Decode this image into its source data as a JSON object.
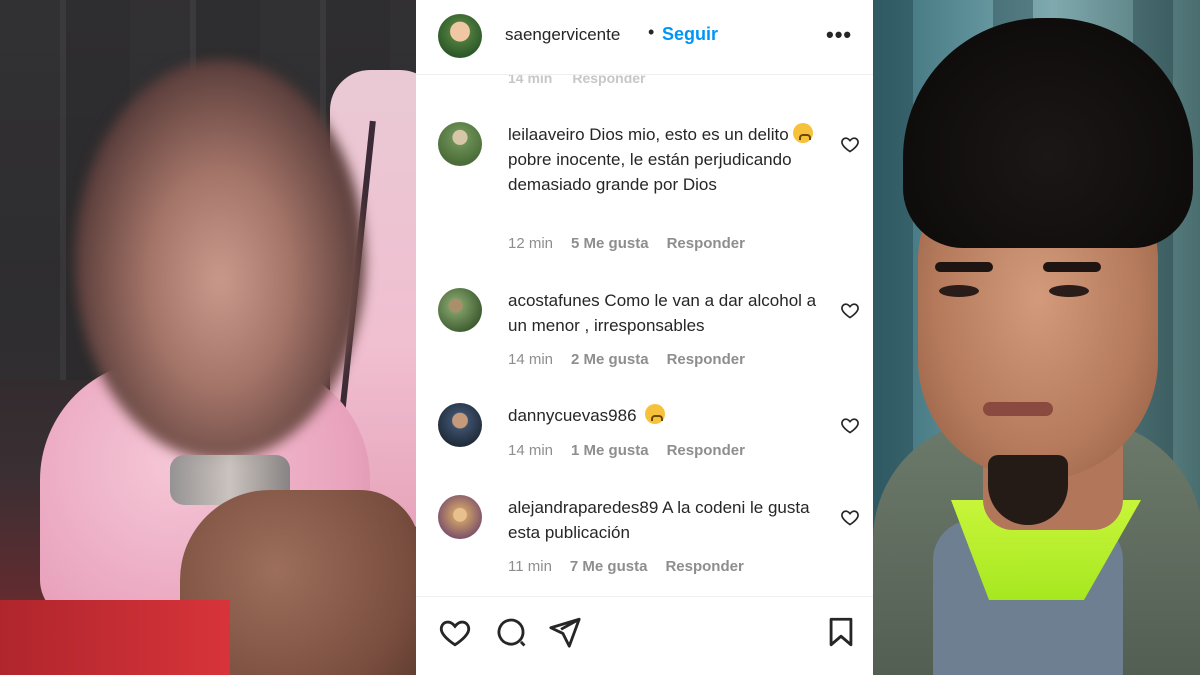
{
  "post": {
    "username": "saengervicente",
    "separator": "•",
    "follow_label": "Seguir",
    "more_label": "•••"
  },
  "ghost_meta": {
    "time": "14 min",
    "reply": "Responder"
  },
  "comments": [
    {
      "username": "leilaaveiro",
      "text": "Dios mio, esto es un delito",
      "emoji": "crying-face",
      "text_after": " pobre inocente, le están perjudicando demasiado grande por Dios",
      "time": "12 min",
      "likes": "5 Me gusta",
      "reply": "Responder",
      "avatar_color": "#6b8f55"
    },
    {
      "username": "acostafunes",
      "text": "Como le van a dar alcohol a un menor , irresponsables",
      "time": "14 min",
      "likes": "2 Me gusta",
      "reply": "Responder",
      "avatar_color": "#7a9a63"
    },
    {
      "username": "dannycuevas986",
      "text": "",
      "emoji": "surprised-face",
      "time": "14 min",
      "likes": "1 Me gusta",
      "reply": "Responder",
      "avatar_color": "#3c4f6a"
    },
    {
      "username": "alejandraparedes89",
      "text": "A la codeni le gusta esta publicación",
      "time": "11 min",
      "likes": "7 Me gusta",
      "reply": "Responder",
      "avatar_color": "#c79a6a"
    }
  ],
  "actions": {
    "icons": [
      "heart-icon",
      "comment-icon",
      "share-icon",
      "bookmark-icon"
    ]
  },
  "colors": {
    "follow": "#0095f6",
    "text": "#262626",
    "meta": "#8e8e8e"
  }
}
